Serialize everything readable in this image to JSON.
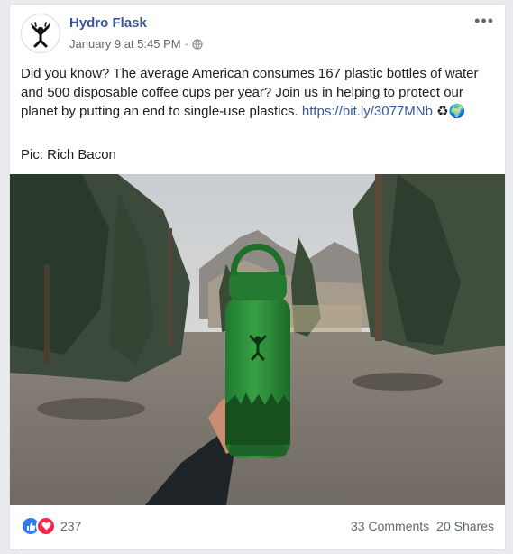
{
  "post": {
    "author": "Hydro Flask",
    "timestamp": "January 9 at 5:45 PM",
    "separator": "·",
    "privacy_icon": "globe-icon",
    "more_icon": "more-options-icon",
    "text_main": "Did you know? The average American consumes 167 plastic bottles of water and 500 disposable coffee cups per year? Join us in helping to protect our planet by putting an end to single-use plastics. ",
    "link_text": "https://bit.ly/3077MNb",
    "emoji": "♻🌍",
    "credit": "Pic: Rich Bacon",
    "image_icon": "hydro-flask-bottle-photo"
  },
  "reactions": {
    "icons": [
      "like-icon",
      "love-icon"
    ],
    "count": "237",
    "comments": "33 Comments",
    "shares": "20 Shares"
  },
  "colors": {
    "brand_link": "#385898",
    "bottle_green": "#2e8b3a",
    "like_blue": "#2f7bf6",
    "love_red": "#f0284a"
  }
}
